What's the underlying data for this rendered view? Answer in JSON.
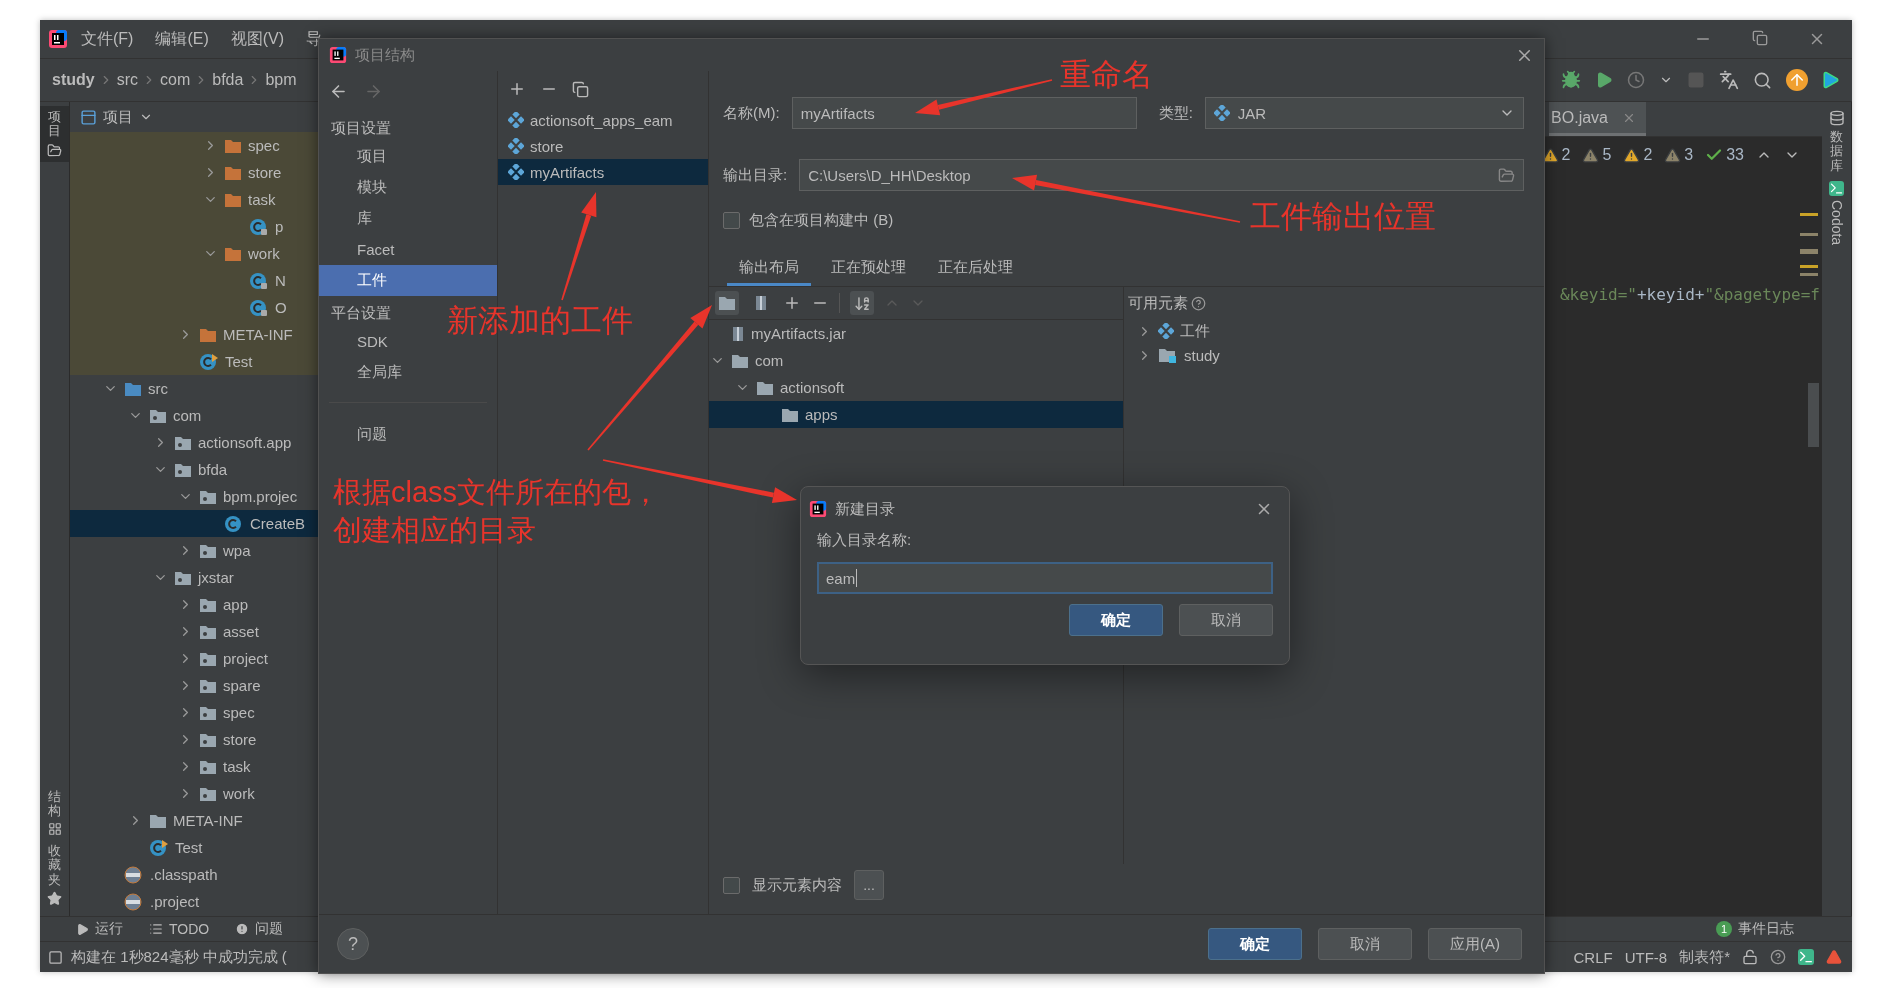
{
  "ide": {
    "menu": [
      "文件(F)",
      "编辑(E)",
      "视图(V)",
      "导"
    ],
    "breadcrumb": [
      "study",
      "src",
      "com",
      "bfda",
      "bpm"
    ],
    "left_strip": [
      {
        "kind": "project",
        "label": "项目"
      },
      {
        "kind": "structure",
        "label": "结构"
      },
      {
        "kind": "favorites",
        "label": "收藏夹"
      }
    ],
    "panel_title": "项目",
    "tree_sections": [
      {
        "kind": "test",
        "nodes": [
          {
            "children": [
              {
                "kind": "folder",
                "label": "spec",
                "expanded": false,
                "selected": false
              },
              {
                "kind": "folder",
                "label": "store",
                "expanded": false,
                "selected": false
              },
              {
                "kind": "folder",
                "label": "task",
                "expanded": true,
                "selected": false,
                "children": [
                  {
                    "kind": "locked-class",
                    "label": "p",
                    "selected": false
                  }
                ]
              },
              {
                "kind": "folder",
                "label": "work",
                "expanded": true,
                "selected": false,
                "children": [
                  {
                    "kind": "locked-class",
                    "label": "N",
                    "selected": false
                  },
                  {
                    "kind": "locked-class",
                    "label": "O",
                    "selected": false
                  }
                ]
              }
            ]
          },
          {
            "kind": "folder",
            "label": "META-INF",
            "expanded": false,
            "selected": false
          },
          {
            "kind": "main-class",
            "label": "Test",
            "selected": false
          }
        ]
      },
      {
        "kind": "main",
        "nodes": [
          {
            "kind": "source-root",
            "label": "src",
            "expanded": true,
            "selected": false,
            "children": [
              {
                "kind": "package",
                "label": "com",
                "expanded": true,
                "selected": false,
                "children": [
                  {
                    "kind": "package",
                    "label": "actionsoft.app",
                    "expanded": false,
                    "selected": false
                  },
                  {
                    "kind": "package",
                    "label": "bfda",
                    "expanded": true,
                    "selected": false,
                    "children": [
                      {
                        "kind": "package",
                        "label": "bpm.projec",
                        "expanded": true,
                        "selected": false,
                        "children": [
                          {
                            "kind": "class",
                            "label": "CreateB",
                            "selected": true
                          }
                        ]
                      },
                      {
                        "kind": "package",
                        "label": "wpa",
                        "expanded": false,
                        "selected": false
                      }
                    ]
                  },
                  {
                    "kind": "package",
                    "label": "jxstar",
                    "expanded": true,
                    "selected": false,
                    "children": [
                      {
                        "kind": "package",
                        "label": "app",
                        "expanded": false,
                        "selected": false
                      },
                      {
                        "kind": "package",
                        "label": "asset",
                        "expanded": false,
                        "selected": false
                      },
                      {
                        "kind": "package",
                        "label": "project",
                        "expanded": false,
                        "selected": false
                      },
                      {
                        "kind": "package",
                        "label": "spare",
                        "expanded": false,
                        "selected": false
                      },
                      {
                        "kind": "package",
                        "label": "spec",
                        "expanded": false,
                        "selected": false
                      },
                      {
                        "kind": "package",
                        "label": "store",
                        "expanded": false,
                        "selected": false
                      },
                      {
                        "kind": "package",
                        "label": "task",
                        "expanded": false,
                        "selected": false
                      },
                      {
                        "kind": "package",
                        "label": "work",
                        "expanded": false,
                        "selected": false
                      }
                    ]
                  }
                ]
              },
              {
                "kind": "folder",
                "label": "META-INF",
                "expanded": false,
                "selected": false
              },
              {
                "kind": "main-class",
                "label": "Test",
                "selected": false
              }
            ]
          },
          {
            "kind": "config-file",
            "label": ".classpath",
            "selected": false
          },
          {
            "kind": "config-file",
            "label": ".project",
            "selected": false
          }
        ]
      }
    ],
    "tool_buttons": [
      {
        "kind": "run",
        "label": "运行"
      },
      {
        "kind": "todo",
        "label": "TODO"
      },
      {
        "kind": "problems",
        "label": "问题"
      }
    ],
    "status_message": "构建在 1秒824毫秒 中成功完成 (",
    "editor_tab": "BO.java",
    "inspections": [
      {
        "kind": "warning",
        "count": "2"
      },
      {
        "kind": "weak",
        "count": "5"
      },
      {
        "kind": "warning",
        "count": "2"
      },
      {
        "kind": "weak",
        "count": "3"
      },
      {
        "kind": "ok",
        "count": "33"
      }
    ],
    "code_tokens": [
      {
        "kind": "string",
        "text": "&keyid=\""
      },
      {
        "kind": "plain",
        "text": "+keyid+"
      },
      {
        "kind": "string",
        "text": "\"&pagetype=f"
      }
    ],
    "right_strip": [
      {
        "kind": "database",
        "label": "数据库"
      },
      {
        "kind": "codota",
        "label": "Codota"
      }
    ],
    "event_log": {
      "badge": "1",
      "label": "事件日志"
    },
    "status_items": [
      "CRLF",
      "UTF-8",
      "制表符*"
    ]
  },
  "dialog": {
    "title": "项目结构",
    "nav": [
      {
        "kind": "header",
        "label": "项目设置"
      },
      {
        "kind": "item",
        "label": "项目",
        "selected": false
      },
      {
        "kind": "item",
        "label": "模块",
        "selected": false
      },
      {
        "kind": "item",
        "label": "库",
        "selected": false
      },
      {
        "kind": "item",
        "label": "Facet",
        "selected": false
      },
      {
        "kind": "item",
        "label": "工件",
        "selected": true
      },
      {
        "kind": "header",
        "label": "平台设置"
      },
      {
        "kind": "item",
        "label": "SDK",
        "selected": false
      },
      {
        "kind": "item",
        "label": "全局库",
        "selected": false
      },
      {
        "kind": "problems",
        "label": "问题",
        "selected": false
      }
    ],
    "artifacts": [
      {
        "label": "actionsoft_apps_eam",
        "selected": false
      },
      {
        "label": "store",
        "selected": false
      },
      {
        "label": "myArtifacts",
        "selected": true
      }
    ],
    "name_label": "名称(M):",
    "name_value": "myArtifacts",
    "type_label": "类型:",
    "type_value": "JAR",
    "output_label": "输出目录:",
    "output_value": "C:\\Users\\D_HH\\Desktop",
    "include_in_build": {
      "label": "包含在项目构建中 (B)",
      "checked": false
    },
    "tabs": [
      {
        "label": "输出布局",
        "selected": true
      },
      {
        "label": "正在预处理",
        "selected": false
      },
      {
        "label": "正在后处理",
        "selected": false
      }
    ],
    "layout_tree": [
      {
        "kind": "jar",
        "label": "myArtifacts.jar",
        "selected": false
      },
      {
        "kind": "folder",
        "label": "com",
        "expanded": true,
        "selected": false,
        "children": [
          {
            "kind": "folder",
            "label": "actionsoft",
            "expanded": true,
            "selected": false,
            "children": [
              {
                "kind": "folder",
                "label": "apps",
                "selected": true
              }
            ]
          }
        ]
      }
    ],
    "available_label": "可用元素",
    "available_tree": [
      {
        "kind": "artifact",
        "label": "工件",
        "expanded": false,
        "selected": false
      },
      {
        "kind": "module",
        "label": "study",
        "expanded": false,
        "selected": false
      }
    ],
    "show_content": {
      "label": "显示元素内容",
      "checked": false
    },
    "more_button": "...",
    "help_button": "?",
    "buttons": [
      {
        "kind": "primary",
        "label": "确定"
      },
      {
        "kind": "normal",
        "label": "取消"
      },
      {
        "kind": "normal",
        "label": "应用(A)"
      }
    ]
  },
  "new_dir_dialog": {
    "title": "新建目录",
    "prompt": "输入目录名称:",
    "value": "eam",
    "buttons": [
      {
        "kind": "primary",
        "label": "确定"
      },
      {
        "kind": "normal",
        "label": "取消"
      }
    ]
  },
  "annotations": [
    {
      "text": "重命名"
    },
    {
      "text": "工件输出位置"
    },
    {
      "text": "新添加的工件"
    },
    {
      "text": "根据class文件所在的包，"
    },
    {
      "text": "创建相应的目录"
    }
  ]
}
